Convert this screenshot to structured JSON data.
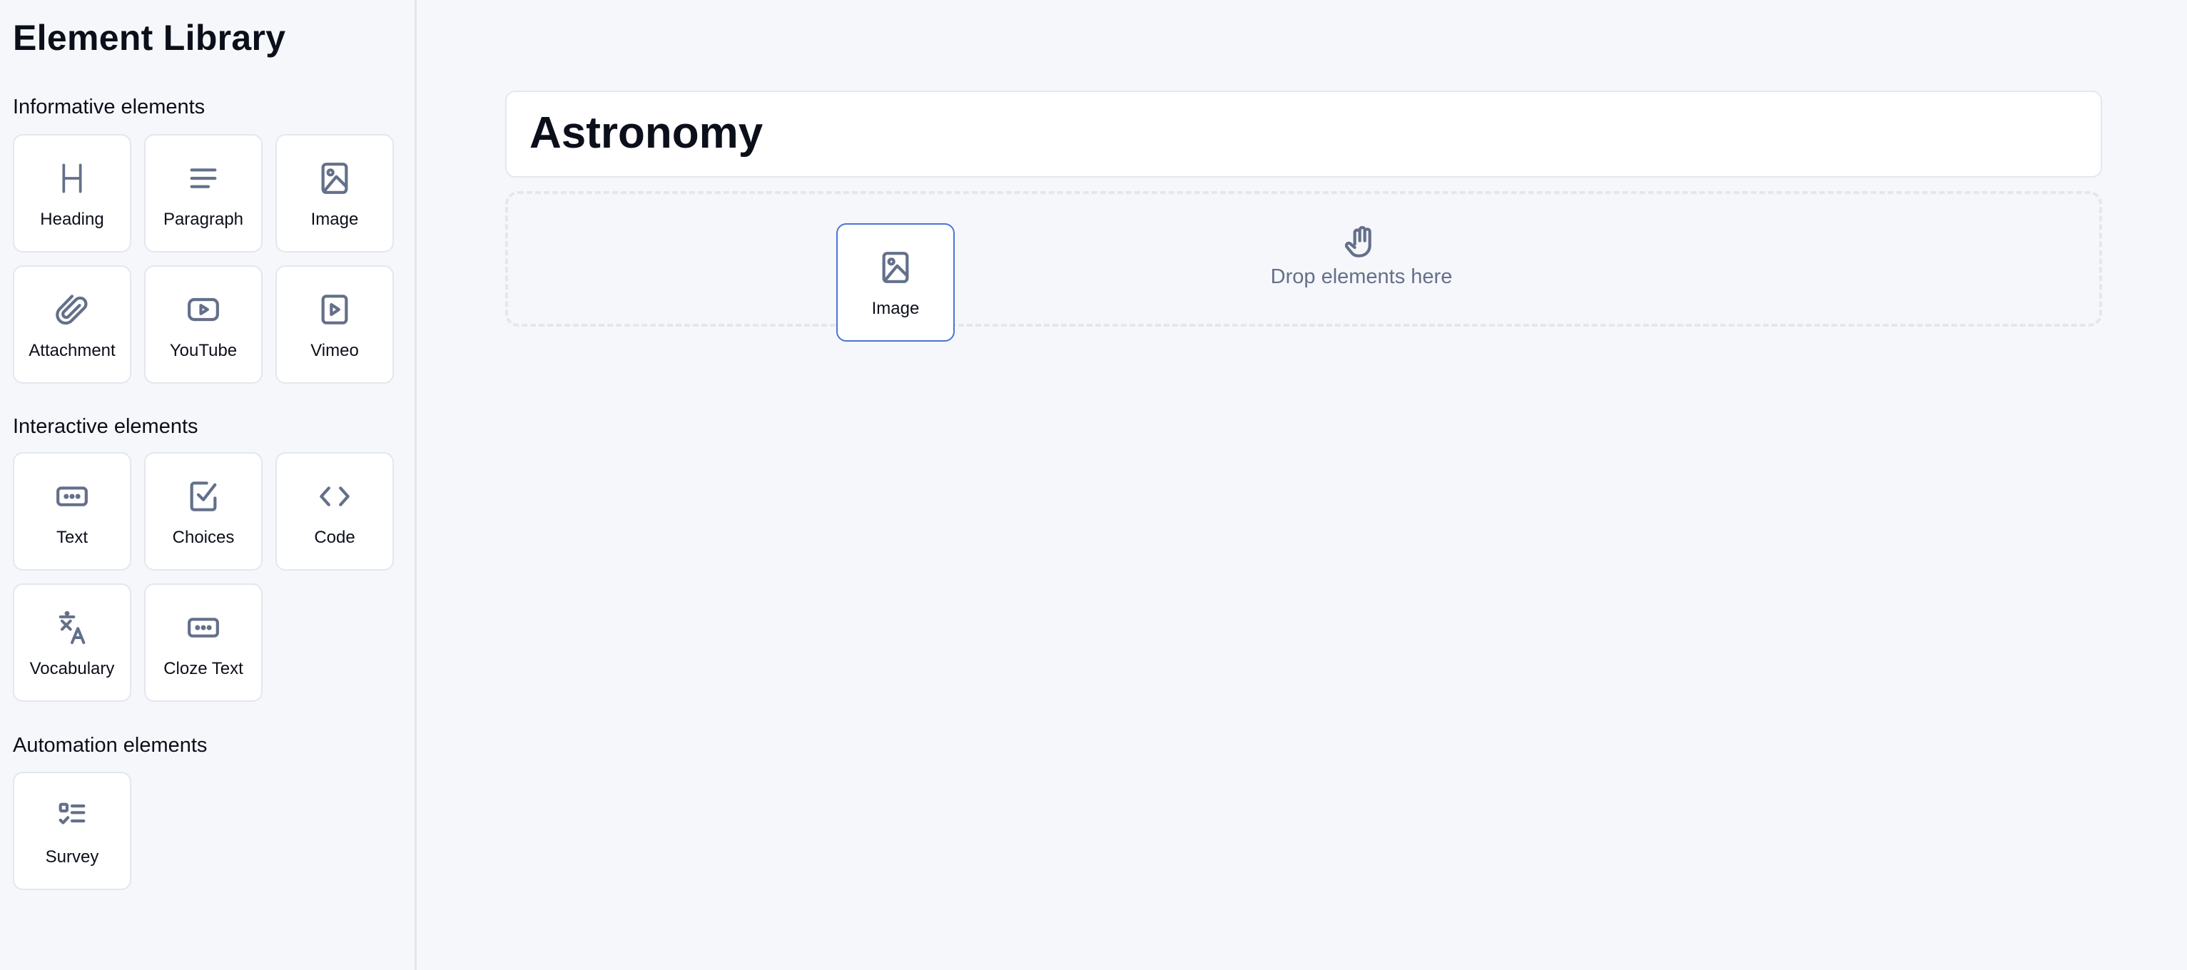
{
  "sidebar": {
    "title": "Element Library",
    "sections": [
      {
        "title": "Informative elements",
        "items": [
          {
            "label": "Heading",
            "icon": "heading-icon"
          },
          {
            "label": "Paragraph",
            "icon": "paragraph-icon"
          },
          {
            "label": "Image",
            "icon": "image-icon"
          },
          {
            "label": "Attachment",
            "icon": "paperclip-icon"
          },
          {
            "label": "YouTube",
            "icon": "youtube-icon"
          },
          {
            "label": "Vimeo",
            "icon": "vimeo-icon"
          }
        ]
      },
      {
        "title": "Interactive elements",
        "items": [
          {
            "label": "Text",
            "icon": "text-input-icon"
          },
          {
            "label": "Choices",
            "icon": "checkbox-icon"
          },
          {
            "label": "Code",
            "icon": "code-icon"
          },
          {
            "label": "Vocabulary",
            "icon": "translate-icon"
          },
          {
            "label": "Cloze Text",
            "icon": "cloze-input-icon"
          }
        ]
      },
      {
        "title": "Automation elements",
        "items": [
          {
            "label": "Survey",
            "icon": "survey-list-icon"
          }
        ]
      }
    ]
  },
  "main": {
    "title": "Astronomy",
    "drop_zone": {
      "hint": "Drop elements here",
      "icon": "hand-icon"
    },
    "dragged_item": {
      "label": "Image",
      "icon": "image-icon"
    }
  },
  "colors": {
    "background": "#f6f7fb",
    "icon": "#64708a",
    "border": "#e3e7ee",
    "drag_accent": "#4a74d6"
  }
}
